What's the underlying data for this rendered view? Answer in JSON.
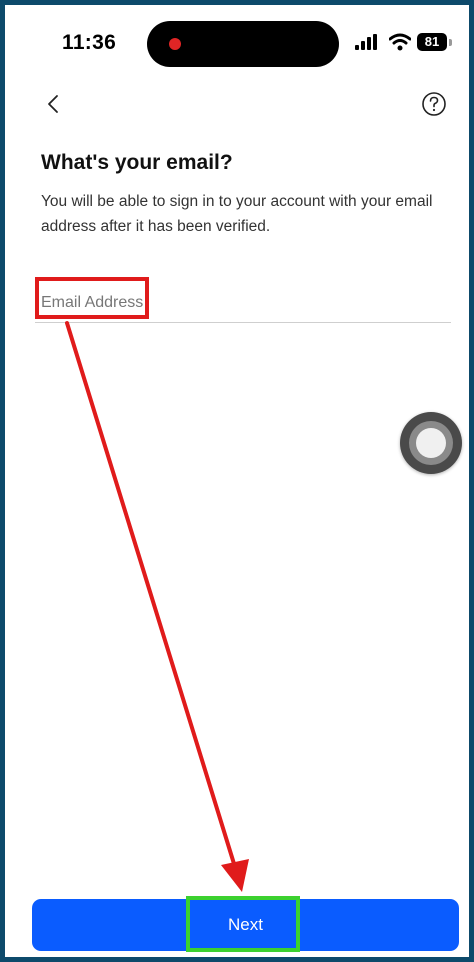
{
  "status_bar": {
    "time": "11:36",
    "battery": "81"
  },
  "nav": {
    "back_icon": "chevron-left-icon",
    "help_icon": "question-circle-icon"
  },
  "content": {
    "title": "What's your email?",
    "subtitle": "You will be able to sign in to your account with your email address after it has been verified."
  },
  "email_field": {
    "placeholder": "Email Address",
    "value": ""
  },
  "footer": {
    "next_label": "Next"
  },
  "colors": {
    "primary_button": "#0a5cff",
    "annotation_red": "#e01b1b",
    "annotation_green": "#3cd12f",
    "frame_border": "#0d4a6b"
  }
}
